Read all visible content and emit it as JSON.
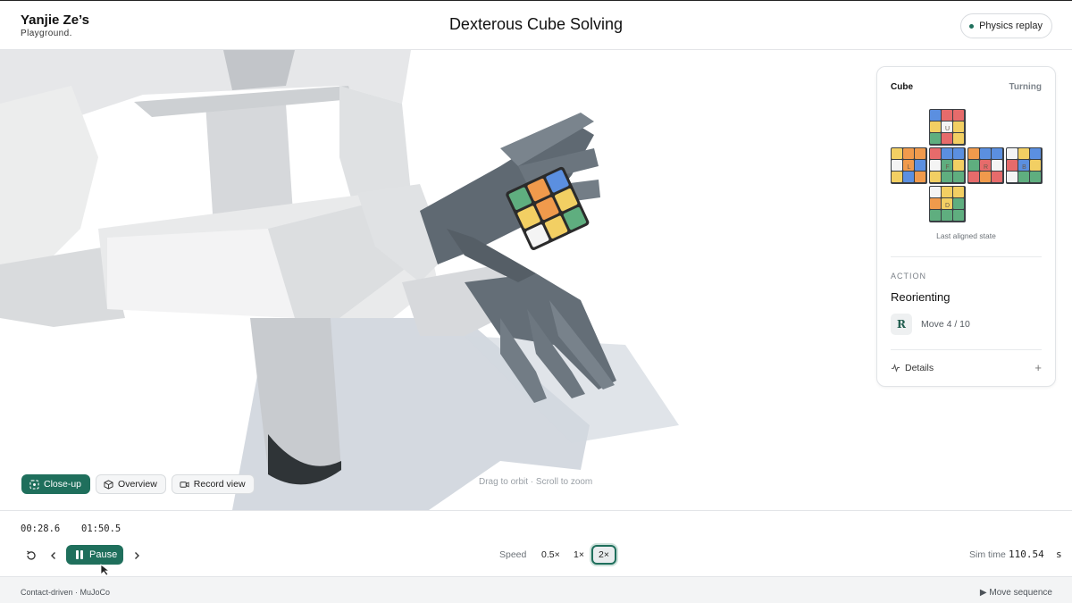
{
  "header": {
    "brand_title": "Yanjie Ze’s",
    "brand_subtitle": "Playground.",
    "page_title": "Dexterous Cube Solving",
    "physics_replay_label": "Physics replay"
  },
  "viewport": {
    "view_buttons": [
      "Close-up",
      "Overview",
      "Record view"
    ],
    "active_view": "Close-up",
    "hint": "Drag to orbit · Scroll to zoom"
  },
  "panel": {
    "title": "Cube",
    "status": "Turning",
    "net_face_labels": {
      "U": "U",
      "L": "L",
      "F": "F",
      "R": "R",
      "B": "B",
      "D": "D"
    },
    "net_caption": "Last aligned state",
    "action_label": "ACTION",
    "action_value": "Reorienting",
    "move_letter": "R",
    "move_text": "Move 4 / 10",
    "details_label": "Details",
    "details_toggle": "+"
  },
  "controls": {
    "time_current": "00:28.6",
    "time_total": "01:50.5",
    "pause_label": "Pause",
    "speed_label": "Speed",
    "speed_options": [
      "0.5×",
      "1×",
      "2×"
    ],
    "speed_selected": "2×",
    "sim_time_label": "Sim time",
    "sim_time_value": "110.54  s"
  },
  "footer": {
    "left": "Contact-driven · MuJoCo",
    "right": "▶ Move sequence"
  },
  "colors": {
    "accent": "#1f6f5c",
    "cube_red": "#e66b6b",
    "cube_blue": "#5b8fe0",
    "cube_yellow": "#f2cf63",
    "cube_green": "#5fae7f",
    "cube_orange": "#f09a4c",
    "cube_white": "#f4f4f4"
  }
}
